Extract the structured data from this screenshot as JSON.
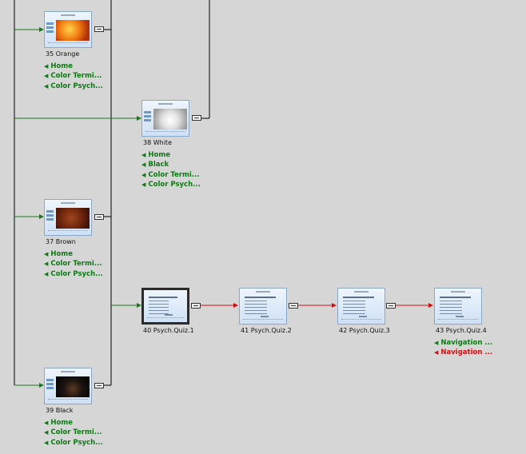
{
  "colors": {
    "background": "#d6d6d6",
    "wire": "#000000",
    "branch_arrow": "#1a7a1a",
    "sequence_arrow": "#d01010",
    "link_green": "#0d7a14",
    "link_red": "#d01010"
  },
  "nodes": {
    "orange": {
      "caption": "35  Orange",
      "links": [
        "Home",
        "Color Termi...",
        "Color Psych..."
      ]
    },
    "white": {
      "caption": "38  White",
      "links": [
        "Home",
        "Black",
        "Color Termi...",
        "Color Psych..."
      ]
    },
    "brown": {
      "caption": "37  Brown",
      "links": [
        "Home",
        "Color Termi...",
        "Color Psych..."
      ]
    },
    "black": {
      "caption": "39  Black",
      "links": [
        "Home",
        "Color Termi...",
        "Color Psych..."
      ]
    },
    "quiz1": {
      "caption": "40  Psych.Quiz.1",
      "selected": true
    },
    "quiz2": {
      "caption": "41  Psych.Quiz.2"
    },
    "quiz3": {
      "caption": "42  Psych.Quiz.3"
    },
    "quiz4": {
      "caption": "43  Psych.Quiz.4",
      "links": [
        "Navigation ...",
        "Navigation ..."
      ]
    }
  }
}
